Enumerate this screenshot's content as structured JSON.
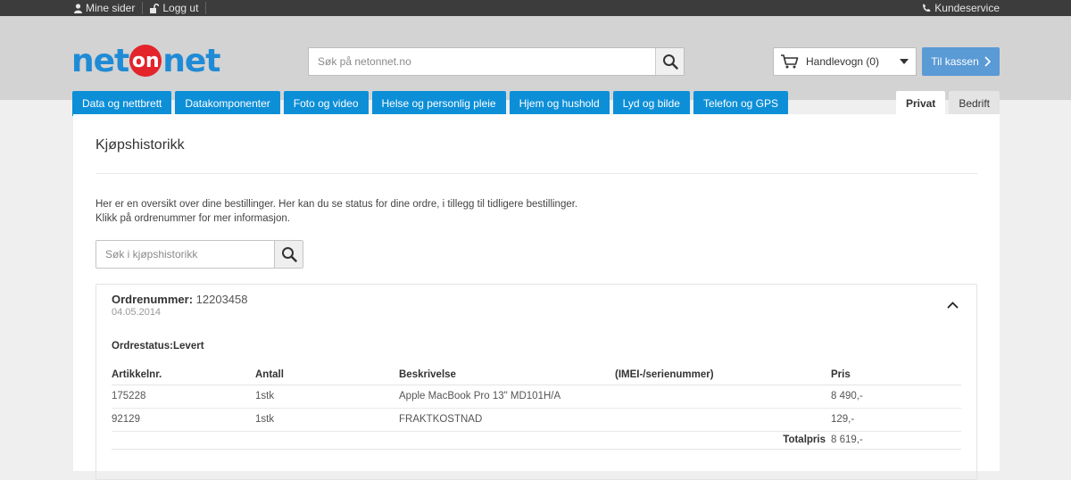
{
  "topbar": {
    "my_pages": "Mine sider",
    "logout": "Logg ut",
    "customer_service": "Kundeservice"
  },
  "header": {
    "logo_net1": "net",
    "logo_on": "on",
    "logo_net2": "net",
    "search_placeholder": "Søk på netonnet.no",
    "cart_label": "Handlevogn (0)",
    "checkout_label": "Til kassen",
    "brand_blue": "#0d8fd8",
    "brand_red": "#e3242b"
  },
  "nav": {
    "categories": [
      "Data og nettbrett",
      "Datakomponenter",
      "Foto og video",
      "Helse og personlig pleie",
      "Hjem og hushold",
      "Lyd og bilde",
      "Telefon og GPS"
    ],
    "segments": [
      "Privat",
      "Bedrift"
    ],
    "active_segment": "Privat"
  },
  "main": {
    "title": "Kjøpshistorikk",
    "intro_line1": "Her er en oversikt over dine bestillinger. Her kan du se status for dine ordre, i tillegg til tidligere bestillinger.",
    "intro_line2": "Klikk på ordrenummer for mer informasjon.",
    "history_search_placeholder": "Søk i kjøpshistorikk"
  },
  "order": {
    "number_label": "Ordrenummer:",
    "number": "12203458",
    "date": "04.05.2014",
    "status": "Ordrestatus:Levert",
    "columns": [
      "Artikkelnr.",
      "Antall",
      "Beskrivelse",
      "(IMEI-/serienummer)",
      "Pris"
    ],
    "rows": [
      [
        "175228",
        "1stk",
        "Apple MacBook Pro 13\" MD101H/A",
        "",
        "8 490,-"
      ],
      [
        "92129",
        "1stk",
        "FRAKTKOSTNAD",
        "",
        "129,-"
      ]
    ],
    "total_label": "Totalpris",
    "total_value": "8 619,-"
  }
}
